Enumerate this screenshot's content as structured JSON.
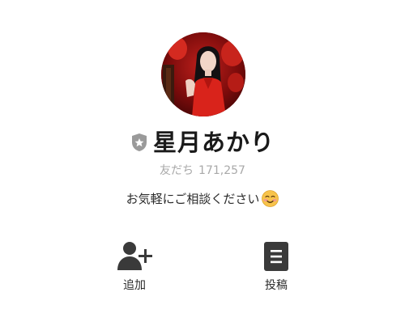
{
  "profile": {
    "name": "星月あかり",
    "friends_label": "友だち",
    "friends_count": "171,257",
    "status_message": "お気軽にご相談ください",
    "status_emoji": "smiling-face-with-blush-emoji",
    "badge_icon": "shield-star-icon"
  },
  "actions": [
    {
      "label": "追加",
      "icon": "add-friend-icon"
    },
    {
      "label": "投稿",
      "icon": "post-document-icon"
    }
  ],
  "colors": {
    "text": "#1a1a1a",
    "muted": "#a9a9a9",
    "icon": "#3a3a3a",
    "badge": "#9a9a9a"
  }
}
